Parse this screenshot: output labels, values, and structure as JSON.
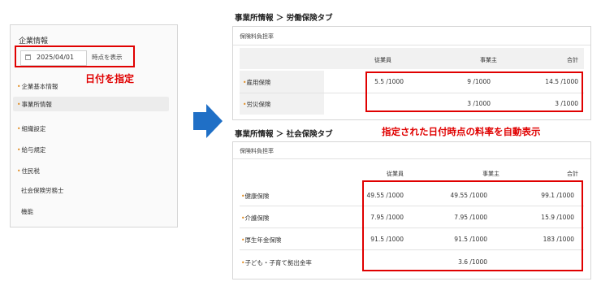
{
  "left_panel": {
    "title": "企業情報",
    "date_value": "2025/04/01",
    "show_button": "時点を表示",
    "callout": "日付を指定",
    "menu": [
      {
        "label": "企業基本情報",
        "dot": true
      },
      {
        "label": "事業所情報",
        "dot": true
      },
      {
        "label": "組織設定",
        "dot": true
      },
      {
        "label": "給与規定",
        "dot": true
      },
      {
        "label": "住民税",
        "dot": true
      },
      {
        "label": "社会保険労務士",
        "dot": false
      },
      {
        "label": "機能",
        "dot": false
      }
    ]
  },
  "labor": {
    "heading": "事業所情報 ＞ 労働保険タブ",
    "card_title": "保険料負担率",
    "columns": [
      "従業員",
      "事業主",
      "合計"
    ],
    "rows": [
      {
        "label": "雇用保険",
        "employee": "5.5 /1000",
        "employer": "9 /1000",
        "total": "14.5 /1000"
      },
      {
        "label": "労災保険",
        "employee": "",
        "employer": "3 /1000",
        "total": "3 /1000"
      }
    ]
  },
  "social": {
    "heading": "事業所情報 ＞ 社会保険タブ",
    "card_title": "保険料負担率",
    "columns": [
      "従業員",
      "事業主",
      "合計"
    ],
    "rows": [
      {
        "label": "健康保険",
        "employee": "49.55 /1000",
        "employer": "49.55 /1000",
        "total": "99.1 /1000"
      },
      {
        "label": "介護保険",
        "employee": "7.95 /1000",
        "employer": "7.95 /1000",
        "total": "15.9 /1000"
      },
      {
        "label": "厚生年金保険",
        "employee": "91.5 /1000",
        "employer": "91.5 /1000",
        "total": "183 /1000"
      },
      {
        "label": "子ども・子育て拠出金率",
        "employee": "",
        "employer": "3.6 /1000",
        "total": ""
      }
    ]
  },
  "callout_right": "指定された日付時点の料率を自動表示",
  "colors": {
    "accent_red": "#e00000",
    "arrow_blue": "#1f6fc6",
    "dot_orange": "#e08a1e"
  }
}
